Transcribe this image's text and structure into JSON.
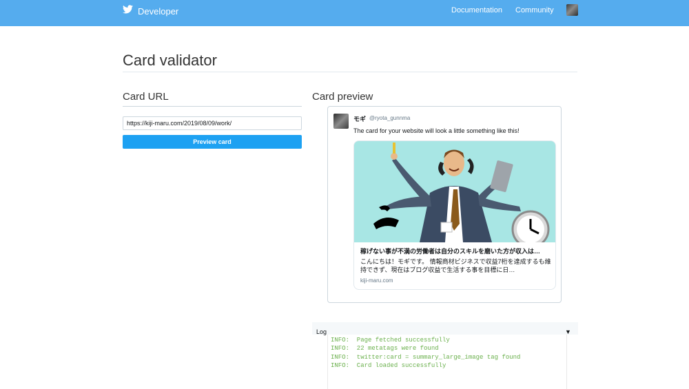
{
  "nav": {
    "brand": "Developer",
    "links": [
      "Documentation",
      "Community"
    ]
  },
  "page": {
    "title": "Card validator"
  },
  "card_url": {
    "heading": "Card URL",
    "value": "https://kiji-maru.com/2019/08/09/work/",
    "button_label": "Preview card"
  },
  "card_preview": {
    "heading": "Card preview",
    "tweet": {
      "name": "モギ",
      "handle": "@ryota_gunnma",
      "text": "The card for your website will look a little something like this!"
    },
    "card": {
      "title": "稼げない事が不満の労働者は自分のスキルを磨いた方が収入は…",
      "description": "こんにちは！モギです。 情報商材ビジネスで収益7桁を達成するも維持できず、現在はブログ収益で生活する事を目標に日…",
      "domain": "kiji-maru.com",
      "image_bg": "#a8e6e4"
    }
  },
  "log": {
    "label": "Log",
    "lines": [
      "INFO:  Page fetched successfully",
      "INFO:  22 metatags were found",
      "INFO:  twitter:card = summary_large_image tag found",
      "INFO:  Card loaded successfully"
    ]
  },
  "colors": {
    "topbar": "#55acee",
    "button": "#1da1f2",
    "log_text": "#6ab04c"
  }
}
